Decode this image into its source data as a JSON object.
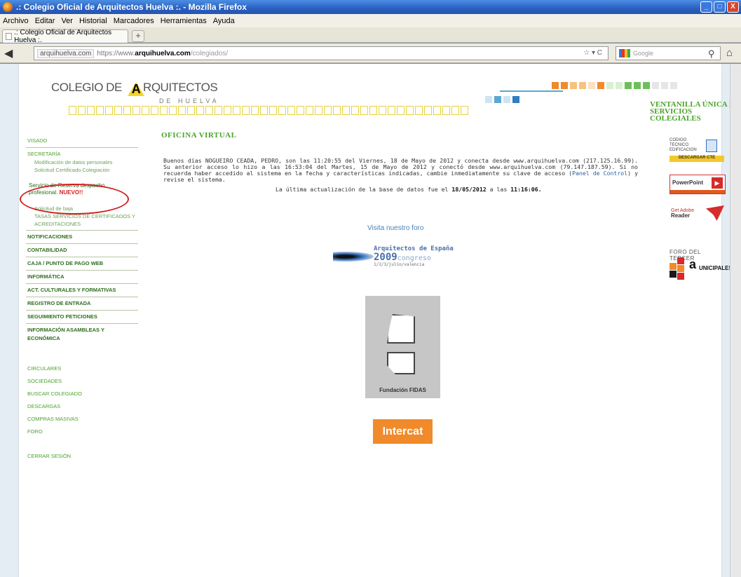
{
  "window": {
    "title": ".: Colegio Oficial de Arquitectos Huelva :. - Mozilla Firefox",
    "min": "_",
    "max": "□",
    "close": "X"
  },
  "menu": [
    "Archivo",
    "Editar",
    "Ver",
    "Historial",
    "Marcadores",
    "Herramientas",
    "Ayuda"
  ],
  "tab": {
    "title": ".: Colegio Oficial de Arquitectos Huelva :.",
    "new": "+"
  },
  "address": {
    "host": "arquihuelva.com",
    "protocol": "https://www.",
    "domain": "arquihuelva.com",
    "path": "/colegiados/",
    "search_placeholder": "Google"
  },
  "header": {
    "logo_prefix": "COLEGIO DE",
    "logo_a": "A",
    "logo_rest": "RQUITECTOS",
    "logo_sub": "DE HUELVA",
    "ventanilla_line1": "VENTANILLA ÚNICA DE",
    "ventanilla_line2": "SERVICIOS COLEGIALES",
    "check": "✓"
  },
  "nav": {
    "visado": "VISADO",
    "secretaria": "SECRETARÍA",
    "sub": [
      "Modificación de datos personales",
      "Solicitud Certificado Colegiación"
    ],
    "reserva_text": "Servicio de Reserva despacho profesional.",
    "reserva_new": "NUEVO!!",
    "sub2": [
      "Solicitud de baja",
      "TASAS SERVICIOS DE CERTIFICADOS Y ACREDITACIONES"
    ],
    "main": [
      "NOTIFICACIONES",
      "CONTABILIDAD",
      "CAJA / PUNTO DE PAGO WEB",
      "INFORMÁTICA",
      "ACT. CULTURALES Y FORMATIVAS",
      "REGISTRO DE ENTRADA",
      "SEGUIMIENTO PETICIONES",
      "INFORMACIÓN ASAMBLEAS Y ECONÓMICA"
    ],
    "secondary": [
      "CIRCULARES",
      "SOCIEDADES",
      "BUSCAR COLEGIADO",
      "DESCARGAS",
      "COMPRAS MASIVAS",
      "FORO"
    ],
    "logout": "CERRAR SESIÓN"
  },
  "main": {
    "heading": "OFICINA VIRTUAL",
    "greeting_a": "Buenos días NOGUEIRO CEADA, PEDRO, son las 11:20:55 del Viernes, 18 de Mayo de 2012 y conecta desde www.arquihuelva.com (217.125.16.99). Su anterior acceso lo hizo a las 16:53:04 del Martes, 15 de Mayo de 2012 y conectó desde www.arquihuelva.com (79.147.187.59). Si no recuerda haber accedido al sistema en la fecha y características indicadas, cambie inmediatamente su clave de acceso (",
    "panel_link": "Panel de Control",
    "greeting_b": ") y revise el sistema.",
    "updated_prefix": "La última actualización de la base de datos fue el",
    "updated_date": "18/05/2012",
    "updated_mid": "a las",
    "updated_time": "11:16:06.",
    "foro_link": "Visita nuestro foro",
    "congreso_line1": "Arquitectos de España",
    "congreso_year": "2009",
    "congreso_word": "congreso",
    "congreso_dates": "1/2/3/julio/valencia",
    "fidas_label": "Fundación FIDAS",
    "intercat": "Intercat"
  },
  "right": {
    "cte_top": "CODIGO TECNICO EDIFICACION",
    "cte_bottom": "DESCARGAR CTE",
    "ppt": "PowerPoint",
    "adobe_get": "Get Adobe",
    "adobe_reader": "Reader",
    "foro_tercer": "FORO DEL TERCER",
    "municipales": "UNICIPALES",
    "munic_a": "a"
  },
  "colors": {
    "accent_green": "#4aa32a",
    "orange": "#f08a2b",
    "title_blue": "#2a5fc0"
  }
}
